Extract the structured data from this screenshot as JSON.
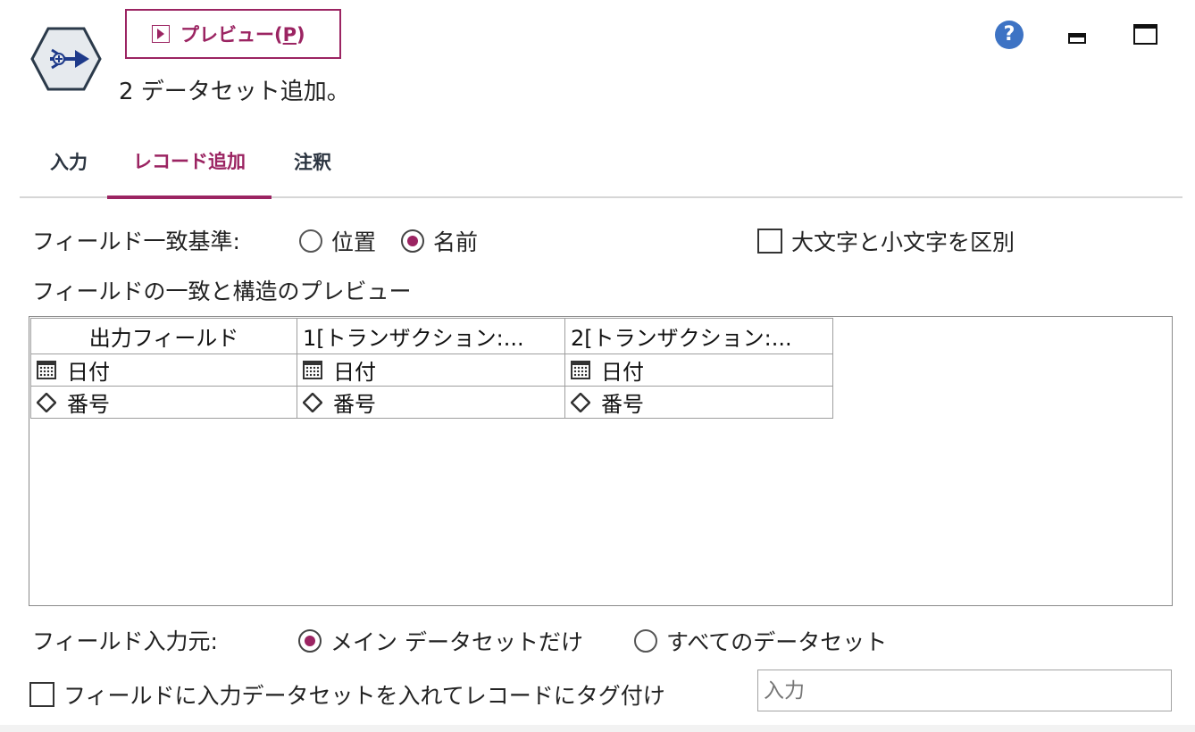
{
  "header": {
    "preview_label": "プレビュー(",
    "preview_mnemonic": "P",
    "preview_suffix": ")",
    "subtitle": "2 データセット追加。"
  },
  "tabs": [
    {
      "label": "入力"
    },
    {
      "label": "レコード追加",
      "active": true
    },
    {
      "label": "注釈"
    }
  ],
  "match": {
    "label": "フィールド一致基準:",
    "options": [
      {
        "label": "位置",
        "selected": false
      },
      {
        "label": "名前",
        "selected": true
      }
    ],
    "case_label": "大文字と小文字を区別",
    "case_checked": false
  },
  "preview_title": "フィールドの一致と構造のプレビュー",
  "grid": {
    "columns": [
      "出力フィールド",
      "1[トランザクション:...",
      "2[トランザクション:..."
    ],
    "rows": [
      {
        "icon": "calendar-icon",
        "cells": [
          "日付",
          "日付",
          "日付"
        ]
      },
      {
        "icon": "diamond-icon",
        "cells": [
          "番号",
          "番号",
          "番号"
        ]
      }
    ]
  },
  "source": {
    "label": "フィールド入力元:",
    "options": [
      {
        "label": "メイン データセットだけ",
        "selected": true
      },
      {
        "label": "すべてのデータセット",
        "selected": false
      }
    ]
  },
  "tag": {
    "checkbox_label": "フィールドに入力データセットを入れてレコードにタグ付け",
    "checked": false,
    "input_placeholder": "入力"
  },
  "colors": {
    "accent": "#9b2462",
    "help": "#3d73c4"
  }
}
